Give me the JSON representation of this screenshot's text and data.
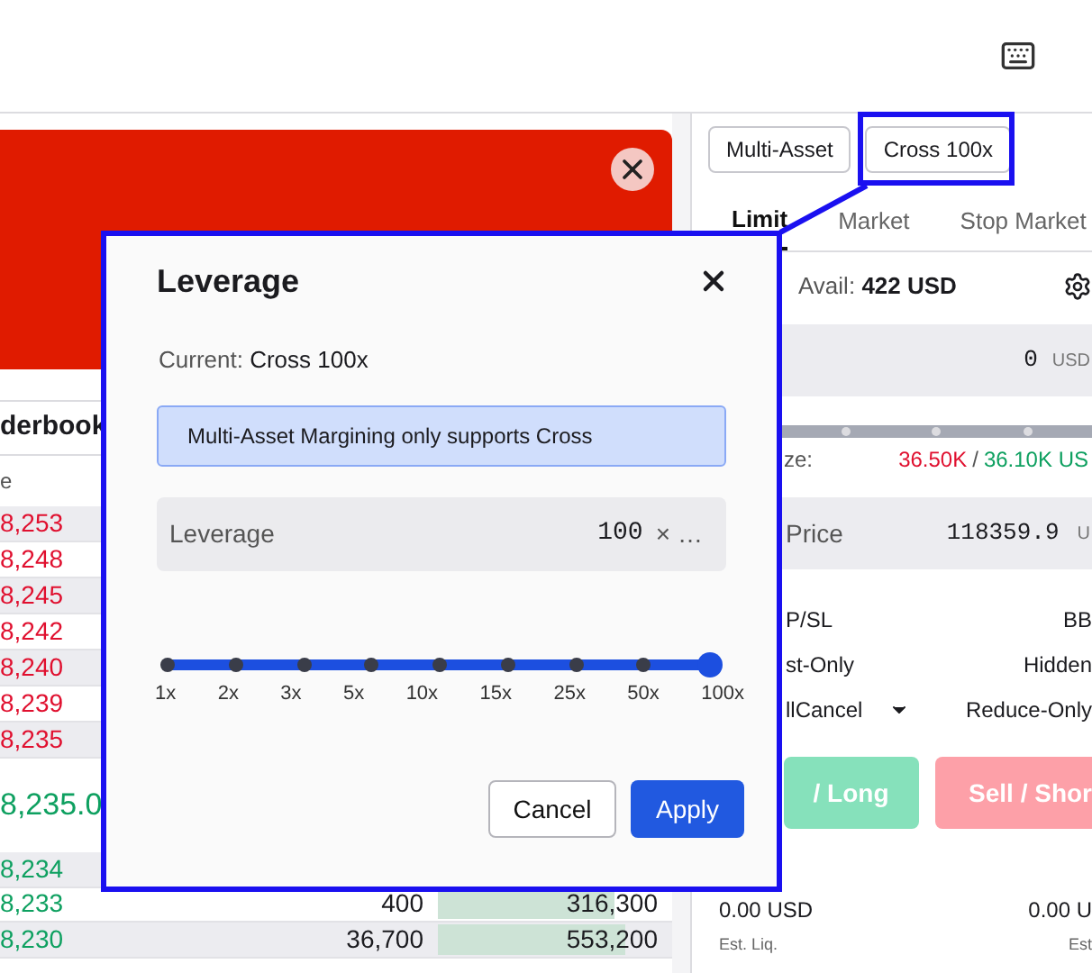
{
  "orderbook": {
    "title": "derbook",
    "column_1": "e",
    "asks": [
      {
        "price": "8,253"
      },
      {
        "price": "8,248"
      },
      {
        "price": "8,245"
      },
      {
        "price": "8,242"
      },
      {
        "price": "8,240"
      },
      {
        "price": "8,239"
      },
      {
        "price": "8,235"
      }
    ],
    "mid_price": "8,235.0",
    "bids": [
      {
        "price": "8,234"
      },
      {
        "price": "8,233",
        "amount": "400",
        "total": "316,300",
        "level": 0.85
      },
      {
        "price": "8,230",
        "amount": "36,700",
        "total": "553,200",
        "level": 0.9
      }
    ]
  },
  "order_panel": {
    "margin_buttons": [
      {
        "label": "Multi-Asset",
        "highlighted": false
      },
      {
        "label": "Cross 100x",
        "highlighted": true
      }
    ],
    "tabs": [
      {
        "label": "Limit",
        "selected": true
      },
      {
        "label": "Market",
        "selected": false
      },
      {
        "label": "Stop Market",
        "selected": false
      }
    ],
    "avail_label": "Avail:",
    "avail_value": "422 USD",
    "amount_value": "0",
    "amount_unit": "USD",
    "size_label": "ze:",
    "size_sell": "36.50K",
    "size_separator": "/",
    "size_buy": "36.10K US",
    "price_label": "Price",
    "price_value": "118359.9",
    "price_unit": "U",
    "options": [
      {
        "left": "P/SL",
        "right": "BB"
      },
      {
        "left": "st-Only",
        "right": "Hidden"
      },
      {
        "left": "llCancel",
        "dropdown": true,
        "right": "Reduce-Only"
      }
    ],
    "buy_button": "/ Long",
    "sell_button": "Sell / Shor",
    "cost_left": "0.00 USD",
    "cost_right": "0.00 U",
    "liq_left": "Est. Liq.",
    "liq_right": "Est"
  },
  "dialog": {
    "title": "Leverage",
    "current_label": "Current:",
    "current_value": "Cross 100x",
    "notice": "Multi-Asset Margining only supports Cross",
    "field_label": "Leverage",
    "field_value": "100",
    "clear_symbol": "×",
    "more_symbol": "…",
    "slider": {
      "level": 1,
      "marks": [
        "1x",
        "2x",
        "3x",
        "5x",
        "10x",
        "15x",
        "25x",
        "50x",
        "100x"
      ]
    },
    "buttons": [
      {
        "label": "Cancel",
        "kind": "secondary"
      },
      {
        "label": "Apply",
        "kind": "primary"
      }
    ]
  }
}
